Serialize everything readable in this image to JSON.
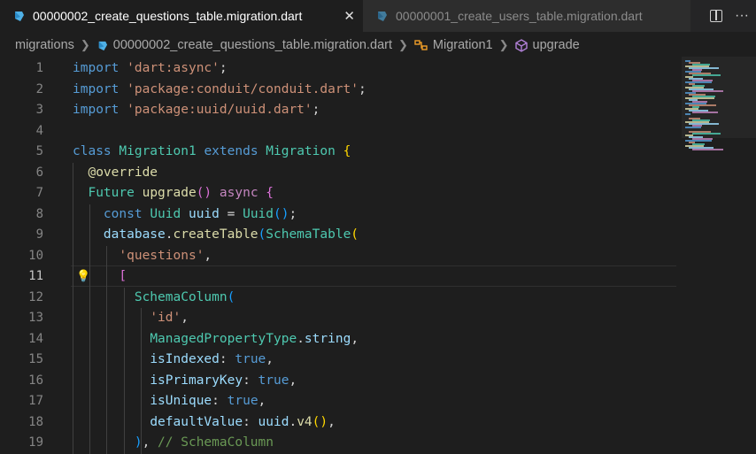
{
  "tabs": [
    {
      "label": "00000002_create_questions_table.migration.dart",
      "close_label": "✕",
      "active": true
    },
    {
      "label": "00000001_create_users_table.migration.dart",
      "active": false
    }
  ],
  "tab_actions": {
    "more_label": "···"
  },
  "breadcrumb": {
    "folder": "migrations",
    "file": "00000002_create_questions_table.migration.dart",
    "class_name": "Migration1",
    "method": "upgrade"
  },
  "editor": {
    "current_line": 11,
    "lines": [
      {
        "n": "1",
        "tokens": [
          [
            "import",
            "kw"
          ],
          [
            " ",
            "pun"
          ],
          [
            "'dart:async'",
            "str"
          ],
          [
            ";",
            "pun"
          ]
        ]
      },
      {
        "n": "2",
        "tokens": [
          [
            "import",
            "kw"
          ],
          [
            " ",
            "pun"
          ],
          [
            "'package:conduit/conduit.dart'",
            "str"
          ],
          [
            ";",
            "pun"
          ]
        ]
      },
      {
        "n": "3",
        "tokens": [
          [
            "import",
            "kw"
          ],
          [
            " ",
            "pun"
          ],
          [
            "'package:uuid/uuid.dart'",
            "str"
          ],
          [
            ";",
            "pun"
          ]
        ]
      },
      {
        "n": "4",
        "tokens": []
      },
      {
        "n": "5",
        "tokens": [
          [
            "class",
            "kw"
          ],
          [
            " ",
            "pun"
          ],
          [
            "Migration1",
            "cls"
          ],
          [
            " ",
            "pun"
          ],
          [
            "extends",
            "kw"
          ],
          [
            " ",
            "pun"
          ],
          [
            "Migration",
            "cls"
          ],
          [
            " ",
            "pun"
          ],
          [
            "{",
            "br1"
          ]
        ]
      },
      {
        "n": "6",
        "tokens": [
          [
            "  ",
            "pun"
          ],
          [
            "@override",
            "fn"
          ]
        ]
      },
      {
        "n": "7",
        "tokens": [
          [
            "  ",
            "pun"
          ],
          [
            "Future",
            "cls"
          ],
          [
            " ",
            "pun"
          ],
          [
            "upgrade",
            "fn"
          ],
          [
            "()",
            "br2"
          ],
          [
            " ",
            "pun"
          ],
          [
            "async",
            "ctl"
          ],
          [
            " ",
            "pun"
          ],
          [
            "{",
            "br2"
          ]
        ]
      },
      {
        "n": "8",
        "tokens": [
          [
            "    ",
            "pun"
          ],
          [
            "const",
            "kw"
          ],
          [
            " ",
            "pun"
          ],
          [
            "Uuid",
            "cls"
          ],
          [
            " ",
            "pun"
          ],
          [
            "uuid",
            "var"
          ],
          [
            " = ",
            "pun"
          ],
          [
            "Uuid",
            "cls"
          ],
          [
            "()",
            "br3"
          ],
          [
            ";",
            "pun"
          ]
        ]
      },
      {
        "n": "9",
        "tokens": [
          [
            "    ",
            "pun"
          ],
          [
            "database",
            "var"
          ],
          [
            ".",
            "pun"
          ],
          [
            "createTable",
            "fn"
          ],
          [
            "(",
            "br3"
          ],
          [
            "SchemaTable",
            "cls"
          ],
          [
            "(",
            "br1"
          ]
        ]
      },
      {
        "n": "10",
        "tokens": [
          [
            "      ",
            "pun"
          ],
          [
            "'questions'",
            "str"
          ],
          [
            ",",
            "pun"
          ]
        ]
      },
      {
        "n": "11",
        "tokens": [
          [
            "      ",
            "pun"
          ],
          [
            "[",
            "br2"
          ]
        ]
      },
      {
        "n": "12",
        "tokens": [
          [
            "        ",
            "pun"
          ],
          [
            "SchemaColumn",
            "cls"
          ],
          [
            "(",
            "br3"
          ]
        ]
      },
      {
        "n": "13",
        "tokens": [
          [
            "          ",
            "pun"
          ],
          [
            "'id'",
            "str"
          ],
          [
            ",",
            "pun"
          ]
        ]
      },
      {
        "n": "14",
        "tokens": [
          [
            "          ",
            "pun"
          ],
          [
            "ManagedPropertyType",
            "cls"
          ],
          [
            ".",
            "pun"
          ],
          [
            "string",
            "var"
          ],
          [
            ",",
            "pun"
          ]
        ]
      },
      {
        "n": "15",
        "tokens": [
          [
            "          ",
            "pun"
          ],
          [
            "isIndexed",
            "var"
          ],
          [
            ": ",
            "pun"
          ],
          [
            "true",
            "kw"
          ],
          [
            ",",
            "pun"
          ]
        ]
      },
      {
        "n": "16",
        "tokens": [
          [
            "          ",
            "pun"
          ],
          [
            "isPrimaryKey",
            "var"
          ],
          [
            ": ",
            "pun"
          ],
          [
            "true",
            "kw"
          ],
          [
            ",",
            "pun"
          ]
        ]
      },
      {
        "n": "17",
        "tokens": [
          [
            "          ",
            "pun"
          ],
          [
            "isUnique",
            "var"
          ],
          [
            ": ",
            "pun"
          ],
          [
            "true",
            "kw"
          ],
          [
            ",",
            "pun"
          ]
        ]
      },
      {
        "n": "18",
        "tokens": [
          [
            "          ",
            "pun"
          ],
          [
            "defaultValue",
            "var"
          ],
          [
            ": ",
            "pun"
          ],
          [
            "uuid",
            "var"
          ],
          [
            ".",
            "pun"
          ],
          [
            "v4",
            "fn"
          ],
          [
            "()",
            "br1"
          ],
          [
            ",",
            "pun"
          ]
        ]
      },
      {
        "n": "19",
        "tokens": [
          [
            "        ",
            "pun"
          ],
          [
            ")",
            "br3"
          ],
          [
            ", ",
            "pun"
          ],
          [
            "// SchemaColumn",
            "cmt"
          ]
        ]
      }
    ]
  },
  "colors": {
    "background": "#1e1e1e",
    "keyword": "#569cd6",
    "string": "#ce9178",
    "class": "#4ec9b0",
    "function": "#dcdcaa"
  }
}
